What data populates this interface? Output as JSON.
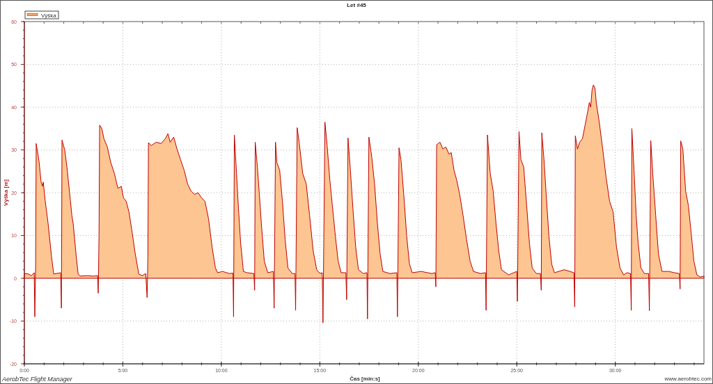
{
  "chart": {
    "chart_data": {
      "type": "area",
      "title": "Let #45",
      "xlabel": "Čas [min:s]",
      "ylabel": "Výška [m]",
      "grid": true,
      "x": [
        0,
        0.21,
        0.35,
        0.5,
        0.53,
        0.57,
        0.6,
        0.74,
        0.85,
        0.92,
        0.96,
        1.06,
        1.2,
        1.38,
        1.49,
        1.74,
        1.84,
        1.88,
        1.91,
        2.05,
        2.16,
        2.34,
        2.41,
        2.48,
        2.62,
        2.73,
        2.83,
        3.15,
        3.51,
        3.72,
        3.75,
        3.79,
        3.82,
        3.93,
        4.04,
        4.21,
        4.39,
        4.57,
        4.75,
        4.92,
        5.03,
        5.17,
        5.31,
        5.45,
        5.63,
        5.81,
        5.98,
        6.16,
        6.23,
        6.27,
        6.3,
        6.44,
        6.69,
        6.94,
        7.15,
        7.29,
        7.4,
        7.58,
        7.75,
        7.93,
        8.11,
        8.29,
        8.46,
        8.64,
        8.82,
        8.99,
        9.17,
        9.35,
        9.53,
        9.7,
        9.81,
        10.06,
        10.41,
        10.59,
        10.62,
        10.66,
        10.77,
        10.87,
        10.98,
        11.12,
        11.3,
        11.65,
        11.69,
        11.72,
        11.83,
        11.93,
        12.04,
        12.18,
        12.36,
        12.64,
        12.68,
        12.75,
        12.82,
        12.96,
        13.1,
        13.24,
        13.38,
        13.6,
        13.74,
        13.77,
        13.85,
        13.95,
        14.13,
        14.31,
        14.48,
        14.66,
        14.84,
        15.01,
        15.12,
        15.16,
        15.26,
        15.37,
        15.51,
        15.65,
        15.79,
        15.93,
        16.08,
        16.32,
        16.36,
        16.43,
        16.54,
        16.68,
        16.82,
        16.96,
        17.21,
        17.39,
        17.42,
        17.49,
        17.63,
        17.78,
        17.92,
        18.06,
        18.2,
        18.56,
        18.91,
        18.94,
        19.02,
        19.12,
        19.26,
        19.41,
        19.55,
        19.69,
        20.15,
        20.68,
        20.86,
        20.89,
        20.93,
        21.1,
        21.25,
        21.39,
        21.56,
        21.67,
        21.81,
        21.95,
        22.1,
        22.27,
        22.45,
        22.63,
        22.8,
        23.16,
        23.41,
        23.44,
        23.51,
        23.65,
        23.8,
        23.94,
        24.08,
        24.22,
        24.58,
        25.0,
        25.03,
        25.11,
        25.21,
        25.35,
        25.5,
        25.64,
        25.78,
        25.99,
        26.2,
        26.24,
        26.27,
        26.38,
        26.49,
        26.63,
        26.77,
        26.91,
        27.41,
        27.9,
        27.94,
        27.97,
        28.08,
        28.19,
        28.33,
        28.47,
        28.61,
        28.68,
        28.75,
        28.82,
        28.89,
        28.97,
        29.04,
        29.18,
        29.36,
        29.53,
        29.71,
        29.89,
        30.06,
        30.24,
        30.42,
        30.59,
        30.77,
        30.81,
        30.84,
        30.95,
        31.06,
        31.16,
        31.3,
        31.48,
        31.69,
        31.73,
        31.8,
        31.9,
        32.05,
        32.19,
        32.37,
        32.72,
        33.0,
        33.25,
        33.29,
        33.32,
        33.43,
        33.57,
        33.71,
        33.85,
        33.99,
        34.14,
        34.31,
        34.5
      ],
      "series": [
        {
          "name": "Výška",
          "color": "#c00000",
          "values": [
            1.1,
            1.0,
            0.6,
            1.3,
            -9.0,
            2.5,
            31.5,
            27.5,
            22.5,
            21.5,
            22.5,
            18,
            13,
            5,
            1,
            1.2,
            1.3,
            -7,
            32.3,
            30,
            26,
            18,
            14.7,
            12.7,
            5.7,
            1,
            0.5,
            0.6,
            0.5,
            0.6,
            -3.5,
            10,
            35.8,
            35,
            32.6,
            30.7,
            27,
            24.5,
            21,
            21.5,
            18.8,
            18,
            15.5,
            11.4,
            5.7,
            1,
            0.6,
            1.1,
            -4.5,
            5,
            31.7,
            31,
            31.8,
            31.5,
            32.6,
            33.8,
            31.8,
            33,
            30.2,
            27.7,
            25.3,
            22,
            20.4,
            19.6,
            20,
            18.8,
            18,
            13.9,
            7.3,
            2.4,
            1.3,
            1.6,
            1.1,
            1.2,
            -9,
            33.5,
            24.5,
            16.3,
            8.2,
            1.6,
            1.3,
            1.1,
            -2.8,
            31.8,
            26,
            19.6,
            12.2,
            4,
            1.3,
            1.6,
            -7,
            31.8,
            27,
            25.3,
            18,
            9,
            2.4,
            1.1,
            1.1,
            -7.5,
            35.2,
            31.8,
            24.5,
            22,
            14.7,
            6.5,
            2,
            1.1,
            1.3,
            -10.4,
            36.5,
            31,
            22.9,
            16.3,
            9.8,
            4,
            1.3,
            1.3,
            -5,
            32.8,
            26,
            16.3,
            7.3,
            2,
            1.1,
            1.3,
            -9.5,
            33,
            28.6,
            22,
            13,
            5.7,
            1.6,
            1.1,
            1.3,
            -9,
            30.5,
            27.7,
            19.6,
            9.8,
            3.3,
            1.3,
            1.6,
            1.1,
            1.3,
            -2,
            31.2,
            31.8,
            30.2,
            30.7,
            29,
            29.4,
            25.3,
            22.9,
            19.6,
            14.7,
            9,
            4,
            1.6,
            1.1,
            1.3,
            -7.5,
            33.5,
            24.5,
            20.4,
            13,
            6.5,
            2,
            0.8,
            1.6,
            -5.4,
            34.3,
            27.7,
            26,
            17,
            8.2,
            2.4,
            1.1,
            1.1,
            -2.8,
            34,
            27.7,
            19.6,
            9.8,
            3.3,
            1.3,
            2,
            1.3,
            -6.7,
            33.3,
            30.2,
            31.8,
            32.6,
            35.9,
            39.2,
            41.1,
            40,
            44,
            45.2,
            44.4,
            40.8,
            36.7,
            30.2,
            23.7,
            18,
            15.5,
            7.3,
            2.4,
            0.8,
            1.3,
            1.1,
            -7.5,
            35,
            25.3,
            14.7,
            8.2,
            2.4,
            1.1,
            1.1,
            -7.6,
            32.2,
            24.5,
            14.7,
            5.7,
            1.6,
            1.6,
            1.3,
            1.1,
            -2.5,
            32.1,
            30.2,
            20.4,
            17,
            10.6,
            4,
            0.8,
            0.3,
            0.5
          ]
        }
      ],
      "xlim": [
        0,
        34.5
      ],
      "ylim": [
        -20,
        60
      ],
      "xticks": [
        {
          "value": 0,
          "label": "0:00"
        },
        {
          "value": 5,
          "label": "5:00"
        },
        {
          "value": 10,
          "label": "10:00"
        },
        {
          "value": 15,
          "label": "15:00"
        },
        {
          "value": 20,
          "label": "20:00"
        },
        {
          "value": 25,
          "label": "25:00"
        },
        {
          "value": 30,
          "label": "30:00"
        }
      ],
      "yticks": [
        -20,
        -10,
        0,
        10,
        20,
        30,
        40,
        50,
        60
      ]
    }
  },
  "footer": {
    "left": "AerobTec Flight Manager",
    "right": "www.aerobtec.com"
  }
}
